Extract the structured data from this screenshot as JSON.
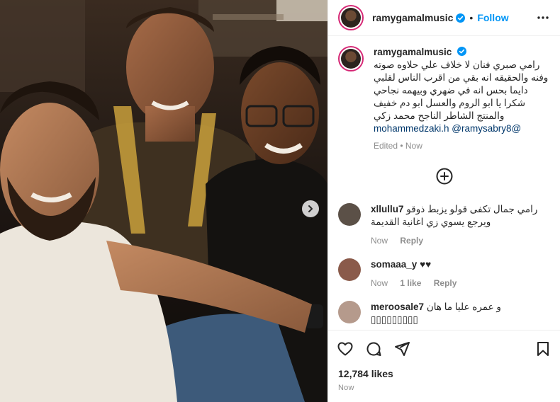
{
  "header": {
    "username": "ramygamalmusic",
    "separator": "•",
    "follow_label": "Follow"
  },
  "caption": {
    "username": "ramygamalmusic",
    "text": "رامي صبري فنان لا خلاف علي حلاوه صوته وفنه والحقيقه انه بقي من اقرب الناس لقلبي دايما بحس انه في ضهري وبيهمه نجاحي شكرا يا ابو الروم والعسل ابو دم خفيف والمنتج الشاطر الناجح محمد زكي",
    "mentions": "mohammedzaki.h @ramysabry8@",
    "meta": "Edited • Now"
  },
  "comments": [
    {
      "username": "xllullu7",
      "text": "رامي جمال تكفى قولو يزبط ذوقو ويرجع يسوي زي اغانية القديمة",
      "time": "Now",
      "likes": "",
      "reply": "Reply",
      "avatar_color": "#5b5047"
    },
    {
      "username": "somaaa_y",
      "text": "♥♥",
      "time": "Now",
      "likes": "1 like",
      "reply": "Reply",
      "avatar_color": "#8a5a4a"
    },
    {
      "username": "meroosale7",
      "text": "و عمره عليا ما هان ▯▯▯▯▯▯▯▯▯",
      "time": "",
      "likes": "",
      "reply": "",
      "avatar_color": "#b59a8c"
    }
  ],
  "likes_label": "12,784 likes",
  "timestamp": "Now",
  "colors": {
    "accent": "#0095f6",
    "verified": "#0095f6",
    "ring": "#d62976",
    "muted": "#8e8e8e"
  },
  "icons": {
    "carousel": "chevron-right-icon",
    "more": "more-horizontal-icon",
    "add_comment": "plus-circle-icon",
    "like": "heart-icon",
    "comment": "comment-icon",
    "share": "share-icon",
    "save": "bookmark-icon"
  }
}
